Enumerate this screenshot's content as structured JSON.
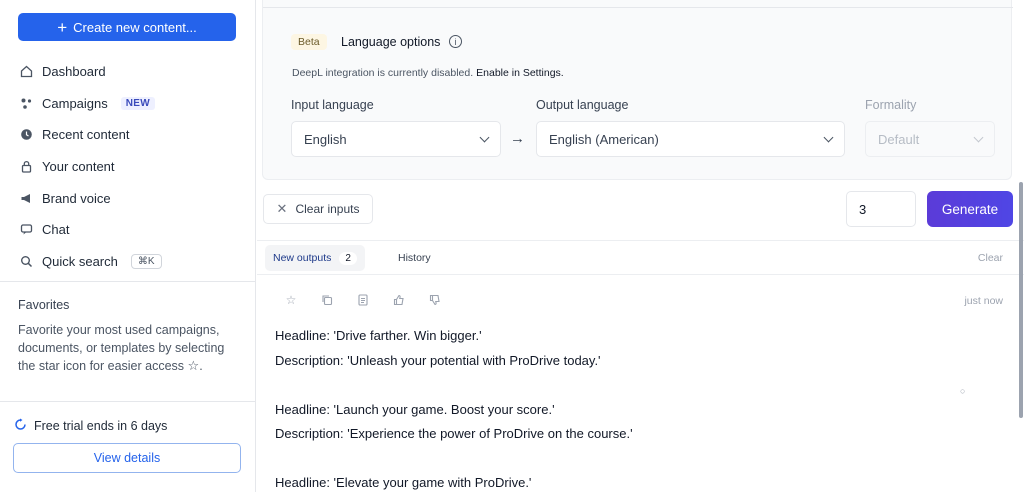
{
  "sidebar": {
    "create_label": "Create new content...",
    "items": [
      {
        "label": "Dashboard",
        "icon": "dashboard-icon"
      },
      {
        "label": "Campaigns",
        "icon": "campaigns-icon",
        "badge": "NEW"
      },
      {
        "label": "Recent content",
        "icon": "clock-icon"
      },
      {
        "label": "Your content",
        "icon": "lock-icon"
      },
      {
        "label": "Brand voice",
        "icon": "megaphone-icon"
      },
      {
        "label": "Chat",
        "icon": "chat-icon"
      },
      {
        "label": "Quick search",
        "icon": "search-icon",
        "shortcut": "⌘K"
      }
    ],
    "favorites_title": "Favorites",
    "favorites_desc": "Favorite your most used campaigns, documents, or templates by selecting the star icon for easier access",
    "trial_text": "Free trial ends in 6 days",
    "view_details": "View details"
  },
  "language": {
    "beta": "Beta",
    "title": "Language options",
    "deepl_note": "DeepL integration is currently disabled.",
    "deepl_link": "Enable in Settings.",
    "input_label": "Input language",
    "input_value": "English",
    "output_label": "Output language",
    "output_value": "English (American)",
    "formality_label": "Formality",
    "formality_value": "Default"
  },
  "controls": {
    "clear_inputs": "Clear inputs",
    "count": "3",
    "generate": "Generate"
  },
  "tabs": {
    "new_outputs": "New outputs",
    "new_count": "2",
    "history": "History",
    "clear": "Clear"
  },
  "output": {
    "timestamp": "just now",
    "lines": [
      "Headline: 'Drive farther. Win bigger.'",
      "Description: 'Unleash your potential with ProDrive today.'",
      "",
      "Headline: 'Launch your game. Boost your score.'",
      "Description: 'Experience the power of ProDrive on the course.'",
      "",
      "Headline: 'Elevate your game with ProDrive.'"
    ]
  },
  "colors": {
    "accent": "#2563eb",
    "generate": "#5b3bd8"
  }
}
